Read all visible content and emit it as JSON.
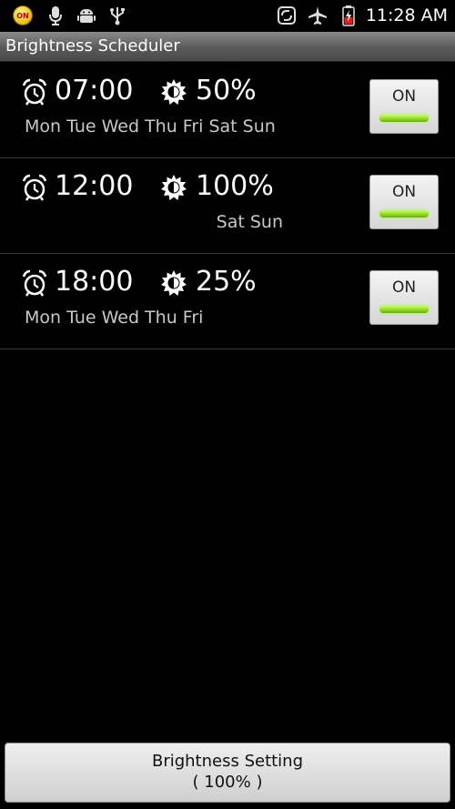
{
  "status_bar": {
    "notification_badge": "ON",
    "time": "11:28 AM",
    "icons": [
      "on-notification-icon",
      "microphone-icon",
      "android-icon",
      "usb-icon",
      "sync-icon",
      "airplane-icon",
      "battery-charging-icon"
    ],
    "accent": "#c00000"
  },
  "app": {
    "title": "Brightness Scheduler"
  },
  "schedules": [
    {
      "time": "07:00",
      "brightness": "50%",
      "days": "Mon Tue Wed Thu Fri Sat Sun",
      "toggle": "ON"
    },
    {
      "time": "12:00",
      "brightness": "100%",
      "days": "Sat Sun",
      "toggle": "ON"
    },
    {
      "time": "18:00",
      "brightness": "25%",
      "days": "Mon Tue Wed Thu Fri",
      "toggle": "ON"
    }
  ],
  "bottom_button": {
    "line1": "Brightness Setting",
    "line2": "( 100% )"
  },
  "colors": {
    "background": "#000000",
    "toggle_on_indicator": "#8ed81c"
  }
}
